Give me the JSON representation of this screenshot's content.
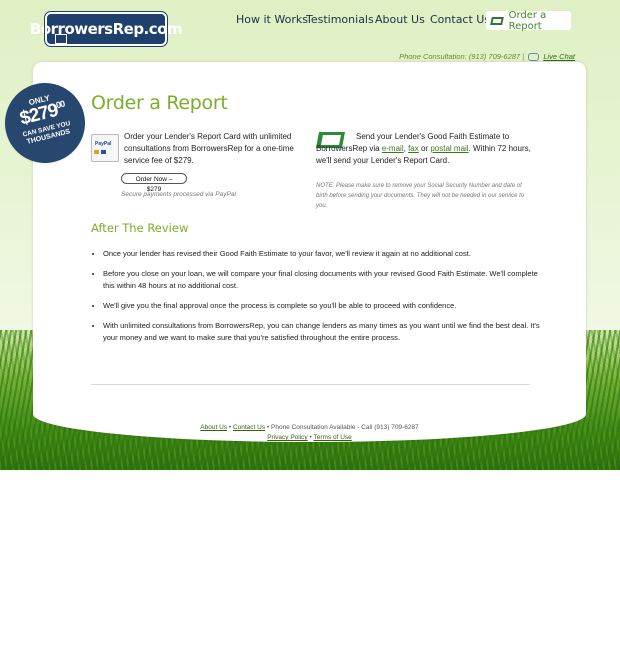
{
  "header": {
    "logo_text": "BorrowersRep.com",
    "nav": [
      {
        "label": "How it Works"
      },
      {
        "label": "Testimonials"
      },
      {
        "label": "About Us"
      },
      {
        "label": "Contact Us"
      }
    ],
    "order_report_label": "Order a Report",
    "phone_text": "Phone Consultation: (913) 709-6287 |",
    "live_chat_label": "Live Chat"
  },
  "badge": {
    "only": "ONLY",
    "price": "$279",
    "price_cents": "00",
    "save": "CAN SAVE YOU",
    "thousands": "THOUSANDS"
  },
  "main": {
    "title": "Order a Report",
    "paypal": {
      "icon_label": "PayPal",
      "text": "Order your Lender's Report Card with unlimited consultations from BorrowersRep for a one-time service fee of $279.",
      "button_label": "Order Now – $279",
      "secure_note": "Secure payments processed via PayPal"
    },
    "gfe": {
      "text_before": "Send your Lender's Good Faith Estimate to BorrowersRep via",
      "email_label": "e-mail",
      "sep1": ",",
      "fax_label": "fax",
      "or": "or",
      "postal_label": "postal mail",
      "text_after": ". Within 72 hours, we'll send your Lender's Report Card.",
      "note": "NOTE: Please make sure to remove your Social Security Number and date of birth before sending your documents. They will not be needed in our service to you."
    },
    "after_title": "After The Review",
    "review_items": [
      "Once your lender has revised their Good Faith Estimate to your favor, we'll review it again at no additional cost.",
      "Before you close on your loan, we will compare your final closing documents with your revised Good Faith Estimate. We'll complete this within 48 hours at no additional cost.",
      "We'll give you the final approval once the process is complete so you'll be able to proceed with confidence.",
      "With unlimited consultations from BorrowersRep, you can change lenders as many times as you want until we find the best deal. It's your money and we want to make sure that you're satisfied throughout the entire process."
    ]
  },
  "footer": {
    "about_label": "About Us",
    "sep": "•",
    "contact_label": "Contact Us",
    "phone_text": "• Phone Consultation Available - Call (913) 709-6287",
    "privacy_label": "Privacy Policy",
    "terms_label": "Terms of Use"
  },
  "colors": {
    "brand_navy": "#1f3f6d",
    "accent_green": "#7cae2a",
    "link_green": "#3a7a1a"
  }
}
